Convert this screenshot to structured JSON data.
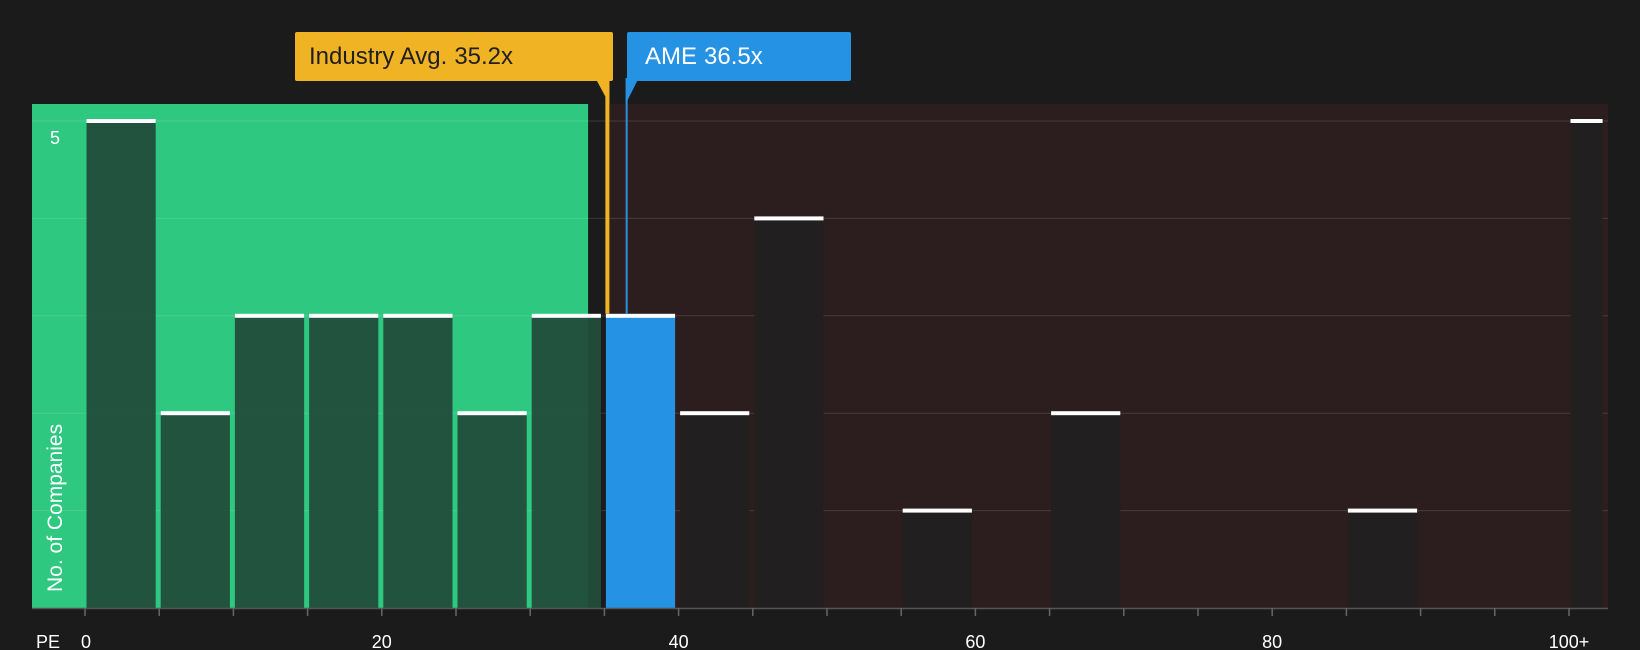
{
  "chart_data": {
    "type": "bar",
    "xlabel": "PE",
    "ylabel": "No. of Companies",
    "xlim": [
      0,
      100
    ],
    "x_tick_labels": [
      "0",
      "20",
      "40",
      "60",
      "80",
      "100+"
    ],
    "y_tick_labels": [
      "5"
    ],
    "ylim": [
      0,
      5
    ],
    "bins": [
      {
        "x0": 0,
        "x1": 5,
        "count": 5
      },
      {
        "x0": 5,
        "x1": 10,
        "count": 2
      },
      {
        "x0": 10,
        "x1": 15,
        "count": 3
      },
      {
        "x0": 15,
        "x1": 20,
        "count": 3
      },
      {
        "x0": 20,
        "x1": 25,
        "count": 3
      },
      {
        "x0": 25,
        "x1": 30,
        "count": 2
      },
      {
        "x0": 30,
        "x1": 35,
        "count": 3
      },
      {
        "x0": 35,
        "x1": 40,
        "count": 3
      },
      {
        "x0": 40,
        "x1": 45,
        "count": 2
      },
      {
        "x0": 45,
        "x1": 50,
        "count": 4
      },
      {
        "x0": 50,
        "x1": 55,
        "count": 0
      },
      {
        "x0": 55,
        "x1": 60,
        "count": 1
      },
      {
        "x0": 60,
        "x1": 65,
        "count": 0
      },
      {
        "x0": 65,
        "x1": 70,
        "count": 2
      },
      {
        "x0": 70,
        "x1": 75,
        "count": 0
      },
      {
        "x0": 75,
        "x1": 80,
        "count": 0
      },
      {
        "x0": 80,
        "x1": 85,
        "count": 0
      },
      {
        "x0": 85,
        "x1": 90,
        "count": 1
      },
      {
        "x0": 90,
        "x1": 95,
        "count": 0
      },
      {
        "x0": 95,
        "x1": 100,
        "count": 0
      },
      {
        "x0": 100,
        "x1": 102.5,
        "count": 5
      }
    ],
    "industry_avg": {
      "label": "Industry Avg.",
      "value": 35.2,
      "display": "35.2x"
    },
    "company": {
      "label": "AME",
      "value": 36.5,
      "display": "36.5x"
    },
    "green_region": [
      -3.7,
      33.9
    ],
    "red_region": [
      35.2,
      102.5
    ],
    "colors": {
      "background": "#1b1b1b",
      "green_region": "#2ec880",
      "red_region": "#2c1e1f",
      "bar_green": "#224d3b",
      "bar_dark": "#211f1f",
      "company_bar": "#2592e3",
      "industry_line": "#f0b323",
      "company_line": "#2592e3"
    }
  }
}
